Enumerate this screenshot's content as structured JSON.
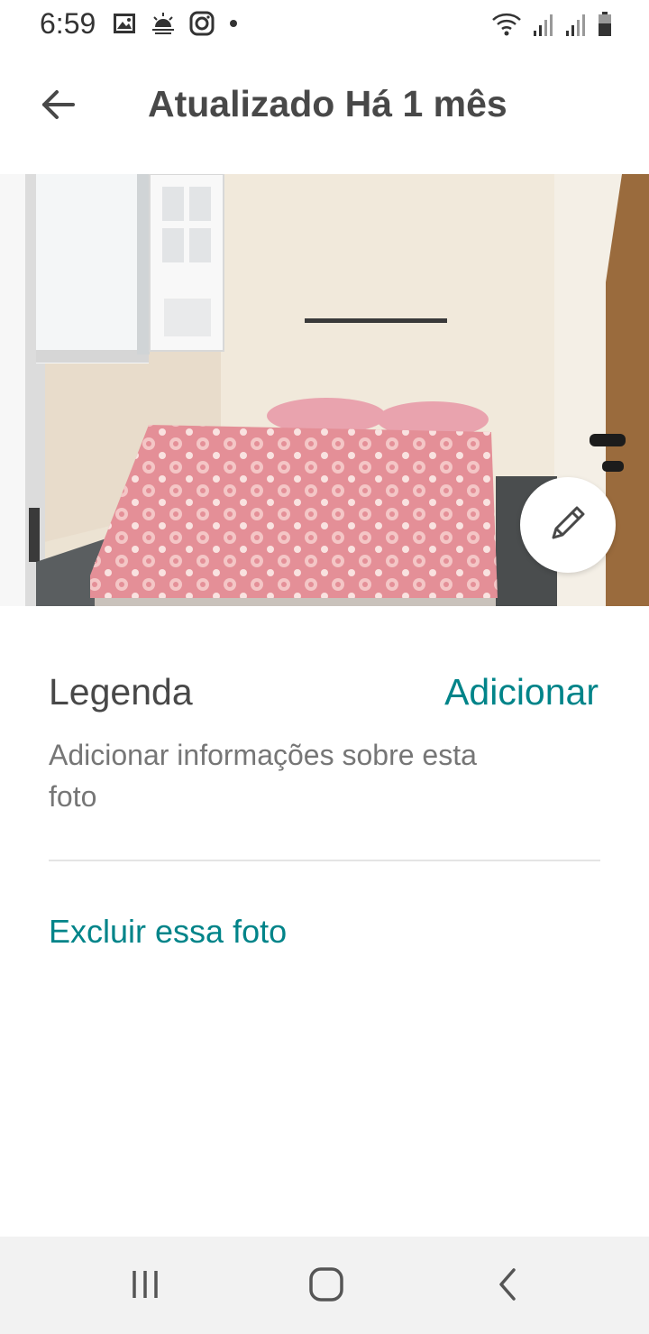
{
  "status_bar": {
    "time": "6:59",
    "left_icons": [
      "image-icon",
      "weather-icon",
      "instagram-icon",
      "dot-icon"
    ],
    "right_icons": [
      "wifi-icon",
      "signal-icon",
      "signal-icon",
      "battery-icon"
    ]
  },
  "header": {
    "title": "Atualizado Há 1 mês",
    "back_icon": "arrow-left-icon"
  },
  "photo": {
    "edit_icon": "pencil-icon"
  },
  "caption": {
    "label": "Legenda",
    "add_label": "Adicionar",
    "hint": "Adicionar informações sobre esta foto"
  },
  "actions": {
    "delete_label": "Excluir essa foto"
  },
  "nav_bar": {
    "recents_icon": "recents-icon",
    "home_icon": "home-icon",
    "back_icon": "nav-back-icon"
  },
  "colors": {
    "accent": "#008489",
    "text": "#484848",
    "muted": "#767676"
  }
}
